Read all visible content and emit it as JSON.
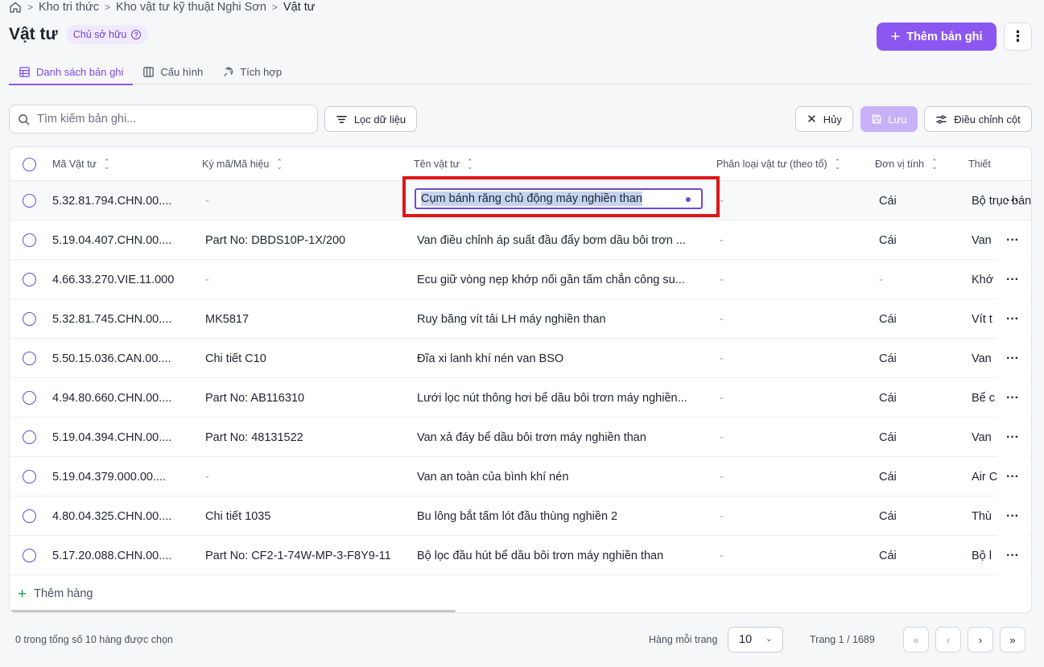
{
  "breadcrumb": {
    "home_icon": "home-icon",
    "items": [
      "Kho tri thức",
      "Kho vật tư kỹ thuật Nghi Sơn",
      "Vật tư"
    ]
  },
  "header": {
    "title": "Vật tư",
    "owner_badge": "Chủ sở hữu",
    "add_button": "Thêm bản ghi",
    "accent_color": "#8c57f0"
  },
  "tabs": [
    {
      "label": "Danh sách bản ghi",
      "icon": "table-icon",
      "active": true
    },
    {
      "label": "Cấu hình",
      "icon": "columns-icon",
      "active": false
    },
    {
      "label": "Tích hợp",
      "icon": "integration-icon",
      "active": false
    }
  ],
  "toolbar": {
    "search_placeholder": "Tìm kiếm bản ghi...",
    "filter_label": "Lọc dữ liệu",
    "cancel_label": "Hủy",
    "save_label": "Lưu",
    "adjust_columns_label": "Điều chỉnh cột"
  },
  "table": {
    "columns": [
      "Mã Vật tư",
      "Ký mã/Mã hiệu",
      "Tên vật tư",
      "Phân loại vật tư (theo tổ)",
      "Đơn vị tính",
      "Thiết"
    ],
    "editing_value": "Cụm bánh răng chủ động máy nghiền than",
    "rows": [
      {
        "code": "5.32.81.794.CHN.00....",
        "mark": "-",
        "name": "Cụm bánh răng chủ động máy nghiền than",
        "category": "-",
        "unit": "Cái",
        "device": "Bộ trục bánh"
      },
      {
        "code": "5.19.04.407.CHN.00....",
        "mark": "Part No: DBDS10P-1X/200",
        "name": "Van điều chỉnh áp suất đầu đẩy bơm dầu bôi trơn ...",
        "category": "-",
        "unit": "Cái",
        "device": "Van"
      },
      {
        "code": "4.66.33.270.VIE.11.000",
        "mark": "-",
        "name": "Ecu giữ vòng nẹp khớp nối gần tấm chắn công su...",
        "category": "-",
        "unit": "-",
        "device": "Khớ"
      },
      {
        "code": "5.32.81.745.CHN.00....",
        "mark": "MK5817",
        "name": "Ruy băng vít tải LH máy nghiền than",
        "category": "-",
        "unit": "Cái",
        "device": "Vít t"
      },
      {
        "code": "5.50.15.036.CAN.00....",
        "mark": "Chi tiết C10",
        "name": "Đĩa xi lanh khí nén van BSO",
        "category": "-",
        "unit": "Cái",
        "device": "Van"
      },
      {
        "code": "4.94.80.660.CHN.00....",
        "mark": "Part No: AB116310",
        "name": "Lưới lọc nút thông hơi bể dầu bôi trơn máy nghiền...",
        "category": "-",
        "unit": "Cái",
        "device": "Bể c"
      },
      {
        "code": "5.19.04.394.CHN.00....",
        "mark": "Part No: 48131522",
        "name": "Van xả đáy bể dầu bôi trơn máy nghiền than",
        "category": "-",
        "unit": "Cái",
        "device": "Van"
      },
      {
        "code": "5.19.04.379.000.00....",
        "mark": "-",
        "name": "Van an toàn của bình khí nén",
        "category": "-",
        "unit": "Cái",
        "device": "Air C"
      },
      {
        "code": "4.80.04.325.CHN.00....",
        "mark": "Chi tiết 1035",
        "name": "Bu lông bắt tấm lót đầu thùng nghiền 2",
        "category": "-",
        "unit": "Cái",
        "device": "Thù"
      },
      {
        "code": "5.17.20.088.CHN.00....",
        "mark": "Part No: CF2-1-74W-MP-3-F8Y9-11",
        "name": "Bộ lọc đầu hút bể dầu bôi trơn máy nghiền than",
        "category": "-",
        "unit": "Cái",
        "device": "Bộ l"
      }
    ],
    "add_row_label": "Thêm hàng"
  },
  "footer": {
    "selection_text": "0 trong tổng số 10 hàng được chọn",
    "rows_per_page_label": "Hàng mỗi trang",
    "rows_per_page_value": "10",
    "page_info": "Trang 1 / 1689"
  }
}
